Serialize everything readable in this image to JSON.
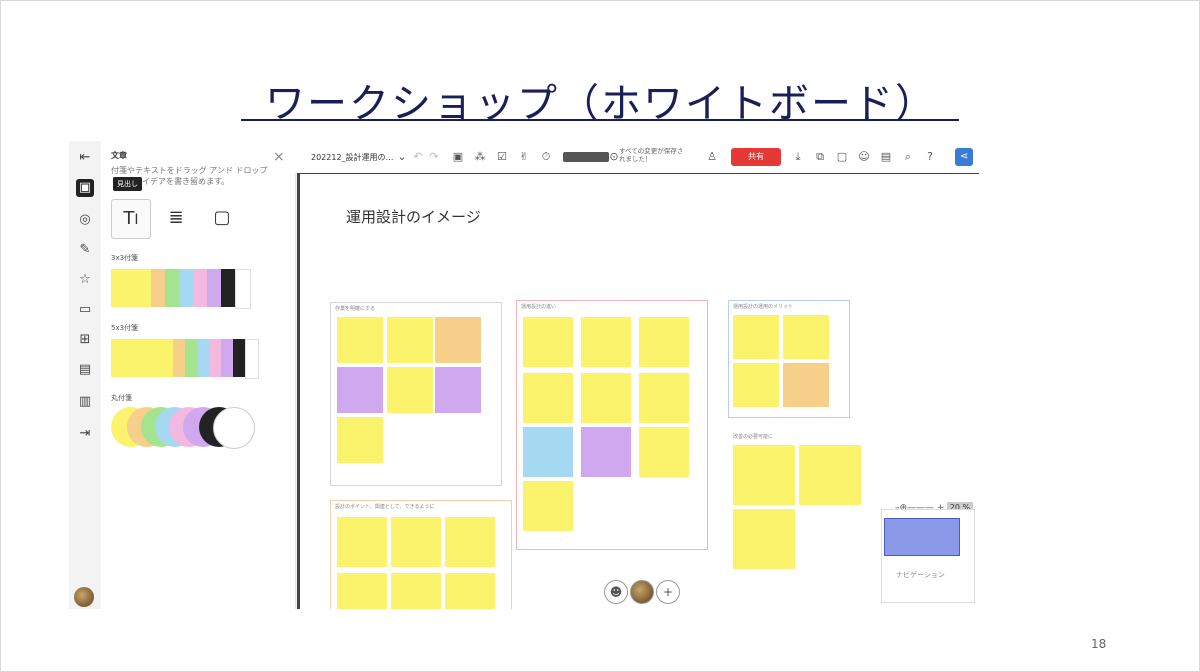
{
  "slide": {
    "title": "ワークショップ（ホワイトボード）",
    "page_number": "18"
  },
  "panel": {
    "title": "文章",
    "description": "付箋やテキストをドラッグ アンド ドロップ して、アイデアを書き留めます。",
    "tooltip": "見出し",
    "sections": [
      "3x3付箋",
      "5x3付箋",
      "丸付箋"
    ]
  },
  "toolbar": {
    "board_name": "202212_設計運用の…",
    "saved_status": "すべての変更が保存されました！",
    "share_label": "共有"
  },
  "canvas": {
    "title": "運用設計のイメージ",
    "frames": [
      {
        "label": "作業を明確にする"
      },
      {
        "label": "運用設計の進い"
      },
      {
        "label": "運用設計の運用のメリット"
      },
      {
        "label": "改善の必要可能に"
      },
      {
        "label": "設計のポイント、関連として、できるように"
      }
    ]
  },
  "zoom": {
    "level": "20 %"
  },
  "minimap": {
    "label": "ナビゲーション"
  },
  "colors": {
    "title": "#1a1f5a",
    "share_button": "#e53935",
    "note_yellow": "#fbf36b",
    "note_orange": "#f6cf8a",
    "note_purple": "#cfa8ef",
    "note_blue": "#a6d8f2"
  }
}
